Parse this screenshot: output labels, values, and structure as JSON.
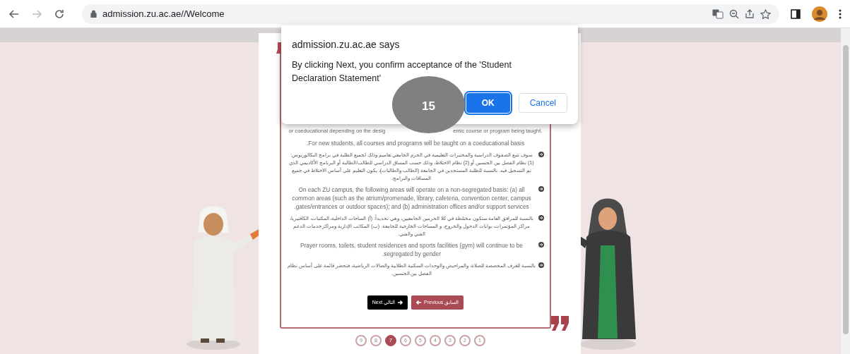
{
  "browser": {
    "url": "admission.zu.ac.ae//Welcome",
    "nav_buttons": [
      {
        "kind": "back",
        "disabled": false
      },
      {
        "kind": "forward",
        "disabled": true
      },
      {
        "kind": "reload",
        "disabled": false
      }
    ]
  },
  "dialog": {
    "title": "admission.zu.ac.ae says",
    "message": "By clicking Next, you confirm acceptance of the 'Student Declaration Statement'",
    "ok_button": {
      "label": "OK",
      "default": true
    },
    "cancel_button": {
      "label": "Cancel",
      "default": false
    }
  },
  "step_badge": "15",
  "declaration": {
    "paragraphs": [
      {
        "kind": "split",
        "left_text": "or coeducational depending on the desig",
        "right_text": "emic course or program being taught."
      },
      {
        "kind": "plain",
        "text": "For new students, all courses and programs will be taught on a coeducational basis."
      },
      {
        "kind": "bullet",
        "text": "سوف تتبع الصفوف الدراسية والمختبرات التعليمية في الحرم الجامعي تعاميم وذلك لجميع الطلبة في برامج البكالوريوس: (1) نظام الفصل بين الجنسين أو (2) نظام الاختلاط، وذلك حسب المساق الدراسي للطالب/الطالبة أو البرنامج الأكاديمي الذي تم التسجيل فيه. بالنسبة للطلبة المستجدين في الجامعة (الطالب والطالبات)، يكون التعليم على أساس الاختلاط في جميع المساقات والبرامج."
      },
      {
        "kind": "bullet",
        "text": "On each ZU campus, the following areas will operate on a non-segregated basis: (a) all common areas (such as the atrium/promenade, library, cafeteria, convention center, campus gates/entrances or outdoor spaces); and (b) administration offices and/or support services."
      },
      {
        "kind": "bullet",
        "text": "بالنسبة للمرافق العامة ستكون مختلطة في كلا الحرمين الجامعيين، وهي تحديداً: (أ) الساحات الداخلية، المكتبات، الكافتيريا، مراكز المؤتمرات، بوابات الدخول والخروج، و المساحات الخارجية للجامعة. (ب) المكاتب الإدارية ومراكز خدمات الدعم الفني والفني."
      },
      {
        "kind": "bullet",
        "text": "Prayer rooms, toilets, student residences and sports facilities (gym) will continue to be segregated by gender."
      },
      {
        "kind": "bullet",
        "text": "بالنسبة للغرف المخصصة للصلاة، والمراحيض والوحدات السكنية الطلابية والصالات الرياضية، فتحضر قائمة على أساس نظام الفصل بين الجنسين."
      }
    ],
    "buttons": [
      {
        "kind": "previous",
        "label": "السابق Previous"
      },
      {
        "kind": "next",
        "label": "التالي Next"
      }
    ]
  },
  "pagination": [
    {
      "label": "1",
      "selected": false
    },
    {
      "label": "2",
      "selected": false
    },
    {
      "label": "3",
      "selected": false
    },
    {
      "label": "4",
      "selected": false
    },
    {
      "label": "5",
      "selected": false
    },
    {
      "label": "6",
      "selected": false
    },
    {
      "label": "7",
      "selected": true
    },
    {
      "label": "8",
      "selected": false
    },
    {
      "label": "9",
      "selected": false
    }
  ]
}
